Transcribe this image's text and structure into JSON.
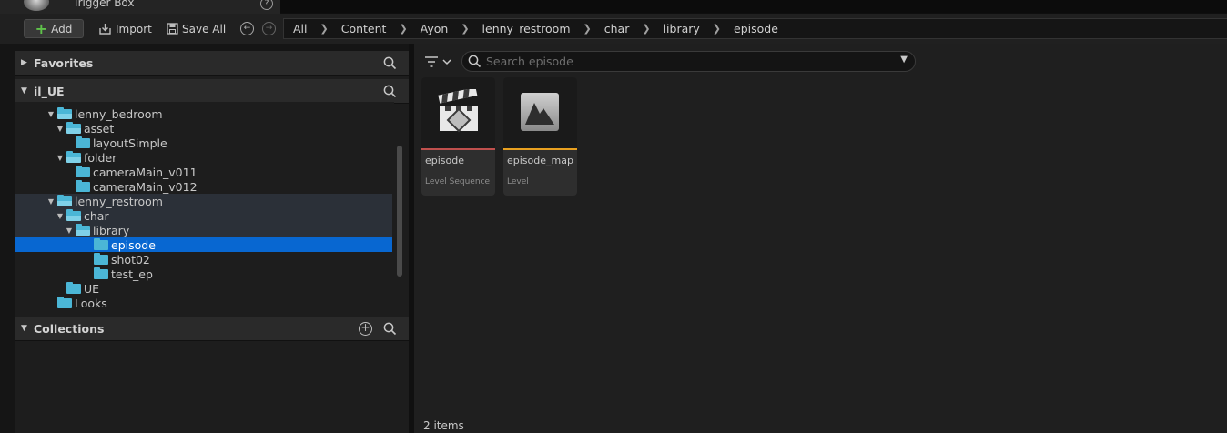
{
  "top": {
    "trigger_label": "Trigger Box",
    "help": "?"
  },
  "toolbar": {
    "add_label": "Add",
    "import_label": "Import",
    "save_all_label": "Save All"
  },
  "breadcrumb": [
    "All",
    "Content",
    "Ayon",
    "lenny_restroom",
    "char",
    "library",
    "episode"
  ],
  "favorites": {
    "title": "Favorites"
  },
  "project": {
    "title": "il_UE"
  },
  "tree": [
    {
      "label": "lenny_bedroom",
      "indent": 2,
      "open": true,
      "highlight": false,
      "selected": false
    },
    {
      "label": "asset",
      "indent": 3,
      "open": true,
      "highlight": false,
      "selected": false
    },
    {
      "label": "layoutSimple",
      "indent": 4,
      "open": false,
      "highlight": false,
      "selected": false
    },
    {
      "label": "folder",
      "indent": 3,
      "open": true,
      "highlight": false,
      "selected": false
    },
    {
      "label": "cameraMain_v011",
      "indent": 4,
      "open": false,
      "highlight": false,
      "selected": false
    },
    {
      "label": "cameraMain_v012",
      "indent": 4,
      "open": false,
      "highlight": false,
      "selected": false
    },
    {
      "label": "lenny_restroom",
      "indent": 2,
      "open": true,
      "highlight": true,
      "selected": false
    },
    {
      "label": "char",
      "indent": 3,
      "open": true,
      "highlight": true,
      "selected": false
    },
    {
      "label": "library",
      "indent": 4,
      "open": true,
      "highlight": true,
      "selected": false
    },
    {
      "label": "episode",
      "indent": 5,
      "open": false,
      "highlight": false,
      "selected": true
    },
    {
      "label": "shot02",
      "indent": 5,
      "open": false,
      "highlight": false,
      "selected": false
    },
    {
      "label": "test_ep",
      "indent": 5,
      "open": false,
      "highlight": false,
      "selected": false
    },
    {
      "label": "UE",
      "indent": 3,
      "open": false,
      "highlight": false,
      "selected": false
    },
    {
      "label": "Looks",
      "indent": 2,
      "open": false,
      "highlight": false,
      "selected": false
    }
  ],
  "collections": {
    "title": "Collections"
  },
  "search": {
    "placeholder": "Search episode"
  },
  "assets": [
    {
      "name": "episode",
      "type": "Level Sequence",
      "color": "#c0504d",
      "icon": "clapperboard-icon"
    },
    {
      "name": "episode_map",
      "type": "Level",
      "color": "#e8a020",
      "icon": "level-icon"
    }
  ],
  "status": {
    "count": "2 items"
  }
}
